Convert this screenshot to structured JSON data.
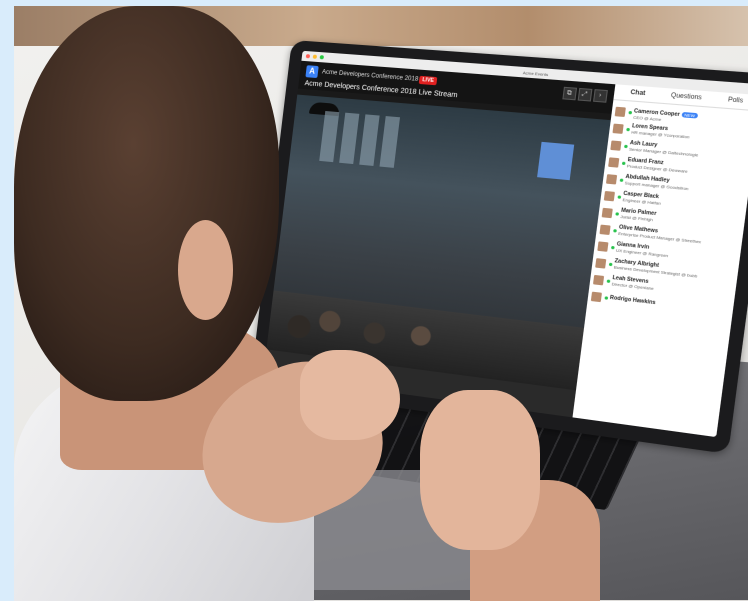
{
  "browser": {
    "url": "Acme Events"
  },
  "stream": {
    "app_logo": "A",
    "conference_name": "Acme Developers Conference 2018 ◉",
    "live_label": "LIVE",
    "title": "Acme Developers Conference 2018 Live Stream",
    "controls": [
      "⧉",
      "⤢",
      "›"
    ]
  },
  "chat": {
    "tabs": [
      "Chat",
      "Questions",
      "Polls"
    ],
    "new_label": "NEW",
    "people": [
      {
        "name": "Cameron Cooper",
        "role": "CEO @ Acme",
        "badge": true
      },
      {
        "name": "Loren Spears",
        "role": "HR manager @ Ycorporation"
      },
      {
        "name": "Ash Laury",
        "role": "Senior Manager @ Daltechnologie"
      },
      {
        "name": "Eduard Franz",
        "role": "Product Designer @ Dewware"
      },
      {
        "name": "Abdullah Hadley",
        "role": "Support manager @ Goodsilron"
      },
      {
        "name": "Casper Black",
        "role": "Engineer @ Hatfan"
      },
      {
        "name": "Mario Palmer",
        "role": "Jurist @ Finhigh"
      },
      {
        "name": "Olive Mathews",
        "role": "Enterprise Product Manager @ Streethex"
      },
      {
        "name": "Gianna Irvin",
        "role": "UX Engineer @ Rangreen"
      },
      {
        "name": "Zachary Albright",
        "role": "Business Development Strategist @ bubb"
      },
      {
        "name": "Leah Stevens",
        "role": "Director @ Openlane"
      },
      {
        "name": "Rodrigo Hawkins",
        "role": ""
      }
    ]
  }
}
